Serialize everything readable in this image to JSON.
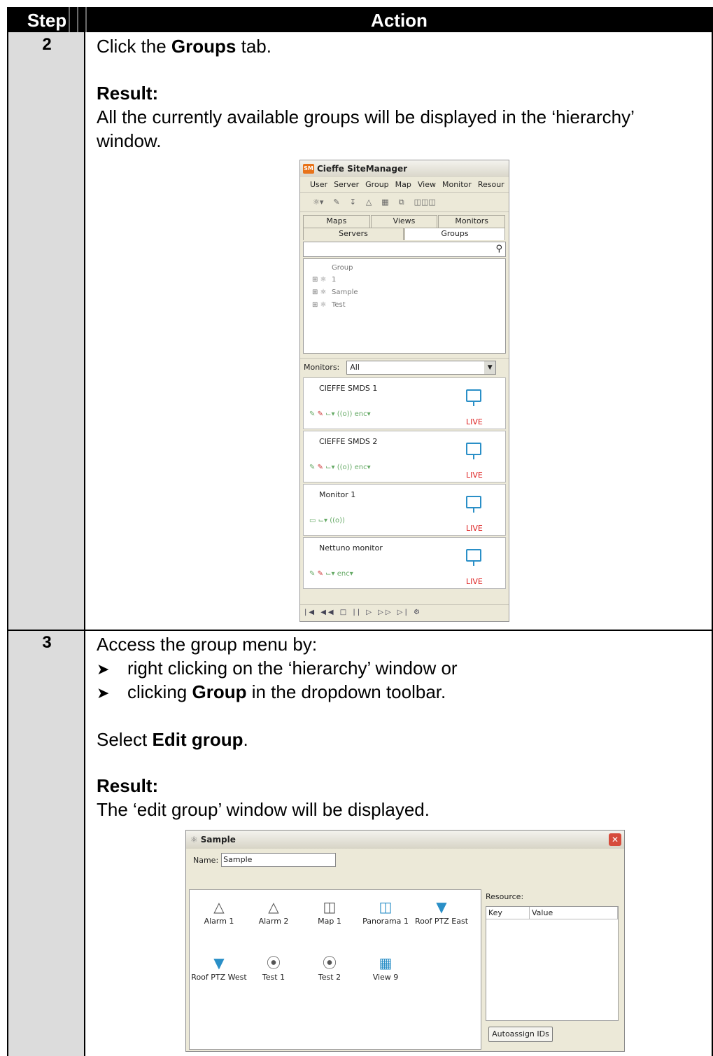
{
  "header": {
    "step": "Step",
    "action": "Action"
  },
  "rows": [
    {
      "step": "2",
      "line1_pre": "Click the ",
      "line1_bold": "Groups",
      "line1_post": " tab.",
      "result_label": "Result:",
      "result_line1": "All the currently available groups will be displayed in the ‘hierarchy’",
      "result_line2": "window."
    },
    {
      "step": "3",
      "intro": "Access the group menu by:",
      "bullet1": "right clicking on the ‘hierarchy’ window or",
      "bullet2_pre": "clicking ",
      "bullet2_bold": "Group",
      "bullet2_post": " in the dropdown toolbar.",
      "select_pre": "Select ",
      "select_bold": "Edit group",
      "select_post": ".",
      "result_label": "Result:",
      "result_text": "The ‘edit group’ window will be displayed."
    }
  ],
  "sitemanager": {
    "title": "Cieffe SiteManager",
    "menu": [
      "User",
      "Server",
      "Group",
      "Map",
      "View",
      "Monitor",
      "Resour"
    ],
    "tabs_top": [
      "Maps",
      "Views",
      "Monitors"
    ],
    "tabs_bottom": [
      "Servers",
      "Groups"
    ],
    "active_tab": "Groups",
    "tree": [
      "Group 1",
      "Sample",
      "Test"
    ],
    "monitors_label": "Monitors:",
    "monitors_value": "All",
    "monitors": [
      {
        "name": "CIEFFE SMDS 1",
        "status": "LIVE"
      },
      {
        "name": "CIEFFE SMDS 2",
        "status": "LIVE"
      },
      {
        "name": "Monitor 1",
        "status": "LIVE"
      },
      {
        "name": "Nettuno monitor",
        "status": "LIVE"
      }
    ]
  },
  "dialog": {
    "title": "Sample",
    "name_label": "Name:",
    "name_value": "Sample",
    "items": [
      "Alarm 1",
      "Alarm 2",
      "Map 1",
      "Panorama 1",
      "Roof PTZ East",
      "Roof PTZ West",
      "Test 1",
      "Test 2",
      "View 9"
    ],
    "resource_label": "Resource:",
    "col_key": "Key",
    "col_value": "Value",
    "autoassign": "Autoassign IDs"
  },
  "colors": {
    "header_bg": "#000000",
    "step_col_bg": "#dcdcdc",
    "icon_blue": "#2a8fc7",
    "live_red": "#dd2222"
  }
}
